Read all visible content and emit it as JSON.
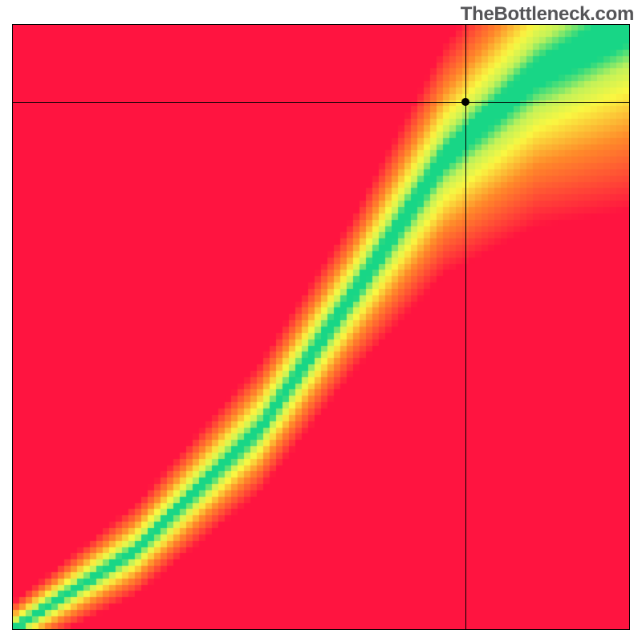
{
  "watermark": "TheBottleneck.com",
  "chart_data": {
    "type": "heatmap",
    "title": "",
    "xlabel": "",
    "ylabel": "",
    "xlim": [
      0,
      1
    ],
    "ylim": [
      0,
      1
    ],
    "crosshair": {
      "x": 0.735,
      "y": 0.872
    },
    "marker": {
      "x": 0.735,
      "y": 0.872
    },
    "grid": false,
    "legend": false,
    "description": "Pixelated gradient heatmap from red (mismatch) through orange/yellow to green along a diagonal band; black crosshair and dot mark a point in the upper-right green region.",
    "colors": {
      "red": "#ff1440",
      "orange": "#ff8a2a",
      "yellow": "#faf842",
      "yellowgreen": "#c2f25a",
      "green": "#18d686"
    },
    "band_control_points": [
      {
        "x": 0.0,
        "y": 0.0,
        "width": 0.02
      },
      {
        "x": 0.2,
        "y": 0.13,
        "width": 0.035
      },
      {
        "x": 0.4,
        "y": 0.33,
        "width": 0.05
      },
      {
        "x": 0.55,
        "y": 0.55,
        "width": 0.06
      },
      {
        "x": 0.7,
        "y": 0.78,
        "width": 0.09
      },
      {
        "x": 0.85,
        "y": 0.92,
        "width": 0.12
      },
      {
        "x": 1.0,
        "y": 1.0,
        "width": 0.15
      }
    ],
    "resolution": 96
  }
}
